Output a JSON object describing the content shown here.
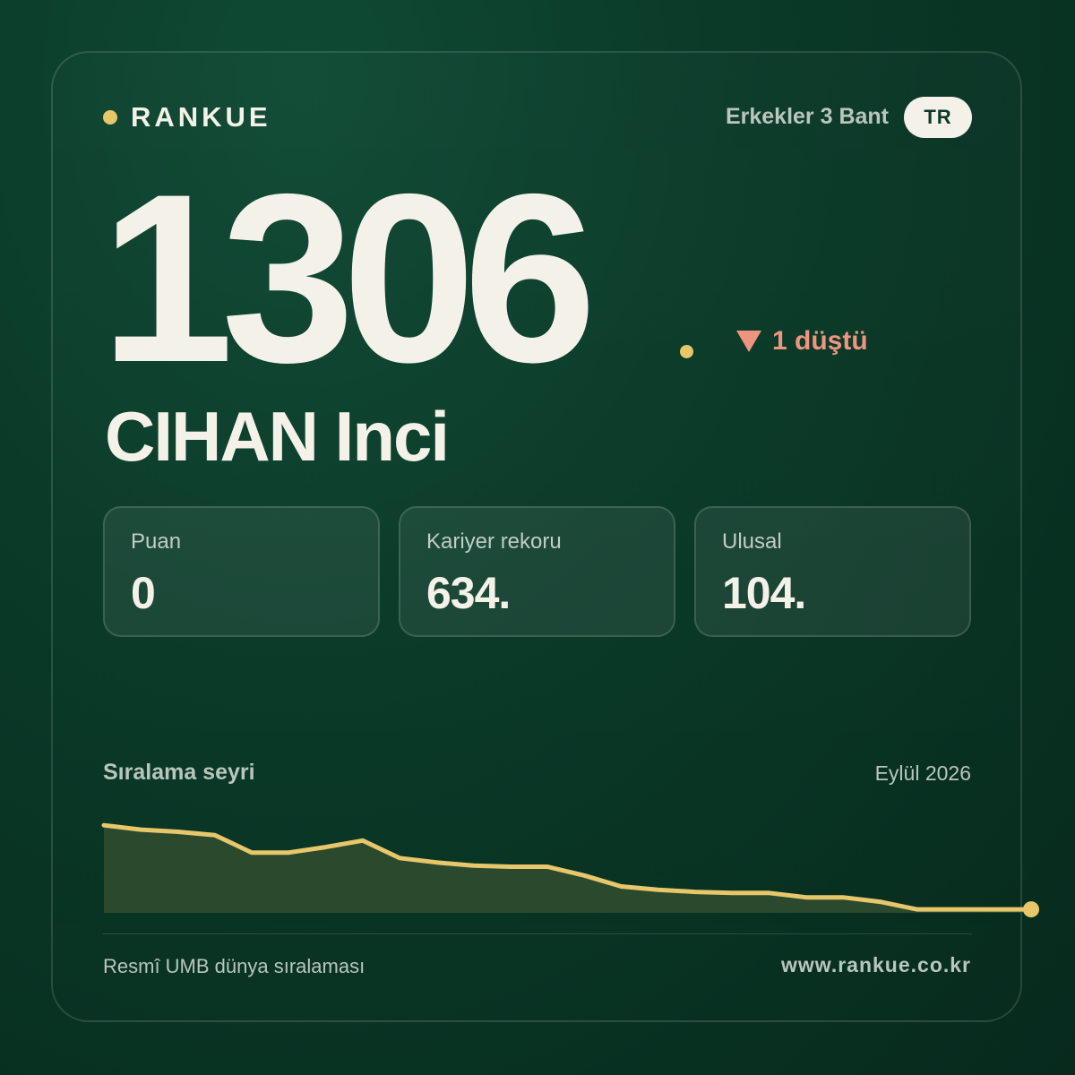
{
  "brand": {
    "name": "RANKUE"
  },
  "header": {
    "category": "Erkekler 3 Bant",
    "country": "TR"
  },
  "rank": {
    "value": "1306",
    "change_text": "1 düştü",
    "change_direction": "down",
    "change_icon": "down-triangle-icon"
  },
  "player": {
    "name": "CIHAN Inci"
  },
  "stats": [
    {
      "label": "Puan",
      "value": "0"
    },
    {
      "label": "Kariyer rekoru",
      "value": "634."
    },
    {
      "label": "Ulusal",
      "value": "104."
    }
  ],
  "chart_section": {
    "title": "Sıralama seyri",
    "date": "Eylül 2026"
  },
  "footer": {
    "source": "Resmî UMB dünya sıralaması",
    "url": "www.rankue.co.kr"
  },
  "colors": {
    "accent": "#e8c76a",
    "down": "#ee9580",
    "background": "#0a3a28",
    "text": "#f4f1e8"
  },
  "chart_data": {
    "type": "area",
    "title": "Sıralama seyri",
    "x": [
      1,
      2,
      3,
      4,
      5,
      6,
      7,
      8,
      9,
      10,
      11,
      12,
      13,
      14,
      15,
      16,
      17,
      18,
      19,
      20,
      21,
      22,
      23,
      24,
      25
    ],
    "values": [
      0.19,
      0.23,
      0.25,
      0.28,
      0.44,
      0.44,
      0.39,
      0.33,
      0.49,
      0.53,
      0.56,
      0.57,
      0.57,
      0.65,
      0.75,
      0.78,
      0.8,
      0.81,
      0.81,
      0.85,
      0.85,
      0.89,
      0.96,
      0.96,
      0.96
    ],
    "y_inverted": true,
    "ylim": [
      0,
      1
    ],
    "grid": false,
    "legend": "none"
  }
}
